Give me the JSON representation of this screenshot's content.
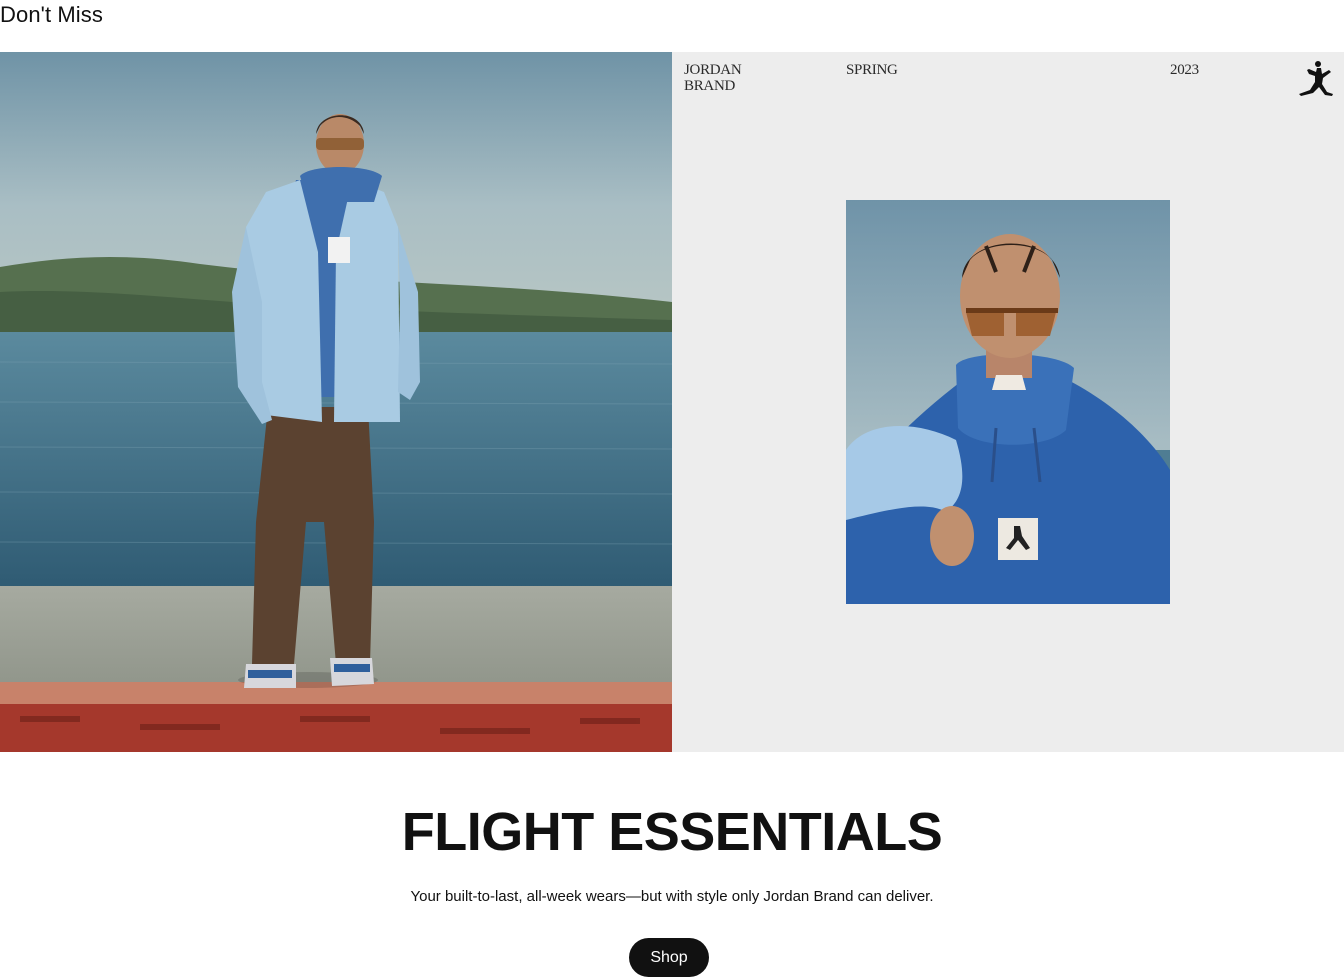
{
  "section": {
    "title": "Don't Miss"
  },
  "hero": {
    "meta_brand": "JORDAN BRAND",
    "meta_season": "SPRING",
    "meta_year": "2023",
    "logo_icon": "jumpman-icon"
  },
  "promo": {
    "headline": "FLIGHT ESSENTIALS",
    "description": "Your built-to-last, all-week wears—but with style only Jordan Brand can deliver.",
    "cta_label": "Shop"
  },
  "colors": {
    "button_bg": "#111111",
    "button_text": "#ffffff",
    "panel_bg": "#ededed"
  }
}
